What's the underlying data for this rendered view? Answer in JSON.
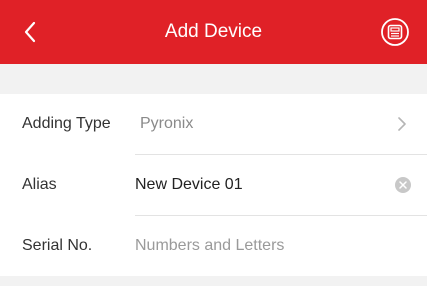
{
  "header": {
    "title": "Add Device",
    "back_icon": "chevron-left-icon",
    "scan_icon": "qr-scan-icon",
    "color": "#e02127"
  },
  "form": {
    "adding_type": {
      "label": "Adding Type",
      "value": "Pyronix"
    },
    "alias": {
      "label": "Alias",
      "value": "New Device 01"
    },
    "serial": {
      "label": "Serial No.",
      "placeholder": "Numbers and Letters",
      "value": ""
    }
  }
}
